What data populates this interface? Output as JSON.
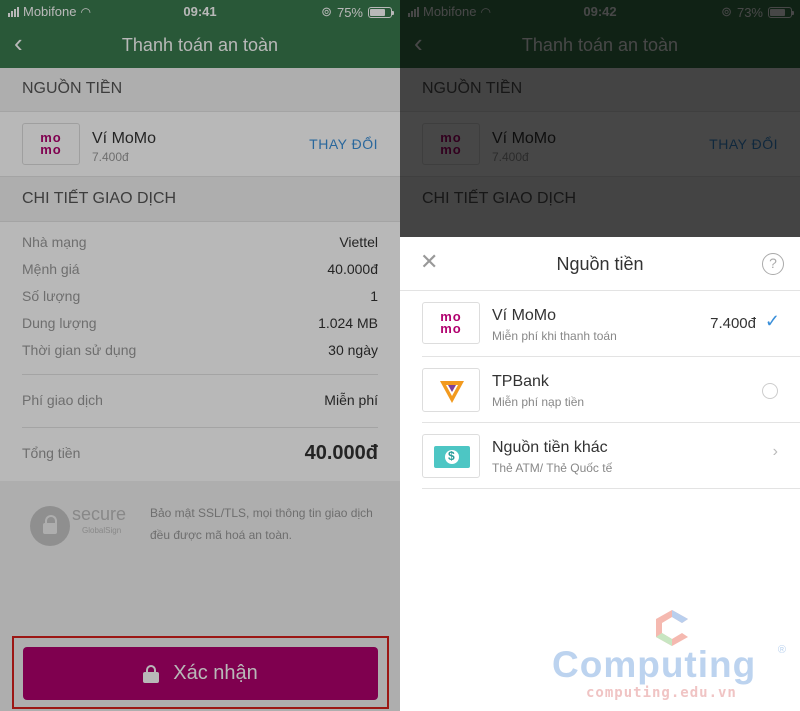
{
  "left": {
    "status": {
      "carrier": "Mobifone",
      "time": "09:41",
      "battery": "75%",
      "battery_fraction": 0.75
    },
    "nav": {
      "title": "Thanh toán an toàn"
    },
    "source_section": "NGUỒN TIỀN",
    "source": {
      "name": "Ví MoMo",
      "balance": "7.400đ",
      "change": "THAY ĐỔI"
    },
    "details_section": "CHI TIẾT GIAO DỊCH",
    "details": [
      {
        "label": "Nhà mạng",
        "value": "Viettel"
      },
      {
        "label": "Mệnh giá",
        "value": "40.000đ"
      },
      {
        "label": "Số lượng",
        "value": "1"
      },
      {
        "label": "Dung lượng",
        "value": "1.024 MB"
      },
      {
        "label": "Thời gian sử dụng",
        "value": "30 ngày"
      }
    ],
    "fee": {
      "label": "Phí giao dịch",
      "value": "Miễn phí"
    },
    "total": {
      "label": "Tổng tiền",
      "value": "40.000đ"
    },
    "secure": {
      "badge": "secure",
      "badge_sub": "GlobalSign",
      "text": "Bảo mật SSL/TLS, mọi thông tin giao dịch đều được mã hoá an toàn."
    },
    "confirm_label": "Xác nhận"
  },
  "right": {
    "status": {
      "carrier": "Mobifone",
      "time": "09:42",
      "battery": "73%",
      "battery_fraction": 0.73
    },
    "sheet": {
      "title": "Nguồn tiền",
      "close_icon": "close-icon",
      "help_icon": "help-icon",
      "options": [
        {
          "name": "Ví MoMo",
          "sub": "Miễn phí khi thanh toán",
          "amount": "7.400đ",
          "state": "selected"
        },
        {
          "name": "TPBank",
          "sub": "Miễn phí nạp tiền",
          "state": "unselected"
        },
        {
          "name": "Nguồn tiền khác",
          "sub": "Thẻ ATM/ Thẻ Quốc tế",
          "state": "navigate"
        }
      ]
    }
  },
  "watermark": {
    "word": "Computing",
    "url": "computing.edu.vn",
    "reg": "®"
  },
  "colors": {
    "nav_green": "#3a7a4e",
    "momo_pink": "#b0006e",
    "link_blue": "#3a8fd9",
    "highlight_red": "#d9201d",
    "tpbank_orange": "#f29a1f"
  }
}
